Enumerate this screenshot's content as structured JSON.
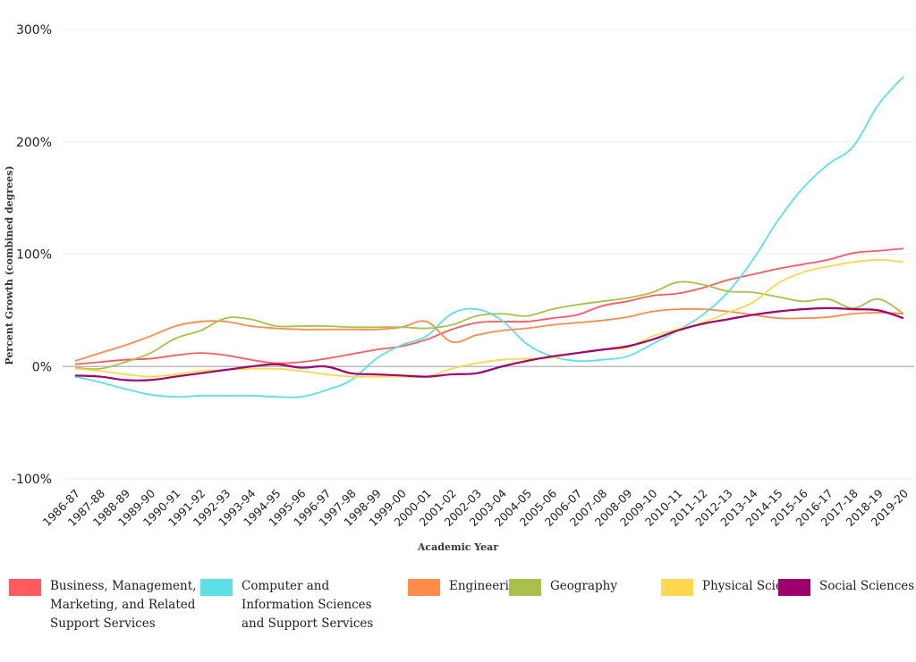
{
  "chart_data": {
    "type": "line",
    "title": "",
    "xlabel": "Academic Year",
    "ylabel": "Percent Growth  (combined degrees)",
    "ylim": [
      -100,
      300
    ],
    "yticks": [
      -100,
      0,
      100,
      200,
      300
    ],
    "ytick_labels": [
      "-100%",
      "0%",
      "100%",
      "200%",
      "300%"
    ],
    "grid": true,
    "legend_position": "bottom",
    "categories": [
      "1986-87",
      "1987-88",
      "1988-89",
      "1989-90",
      "1990-91",
      "1991-92",
      "1992-93",
      "1993-94",
      "1994-95",
      "1995-96",
      "1996-97",
      "1997-98",
      "1998-99",
      "1999-00",
      "2000-01",
      "2001-02",
      "2002-03",
      "2003-04",
      "2004-05",
      "2005-06",
      "2006-07",
      "2007-08",
      "2008-09",
      "2009-10",
      "2010-11",
      "2011-12",
      "2012-13",
      "2013-14",
      "2014-15",
      "2015-16",
      "2016-17",
      "2017-18",
      "2018-19",
      "2019-20"
    ],
    "series": [
      {
        "name": "Business, Management,\nMarketing, and Related\nSupport Services",
        "color": "#ff5a5f",
        "values": [
          2,
          4,
          6,
          7,
          10,
          12,
          10,
          6,
          3,
          4,
          7,
          11,
          15,
          18,
          24,
          33,
          39,
          40,
          40,
          43,
          46,
          54,
          58,
          63,
          65,
          70,
          77,
          82,
          87,
          91,
          95,
          101,
          103,
          105
        ]
      },
      {
        "name": "Computer and\nInformation Sciences\nand Support Services",
        "color": "#5ce0e6",
        "values": [
          -9,
          -14,
          -20,
          -25,
          -27,
          -26,
          -26,
          -26,
          -27,
          -27,
          -21,
          -12,
          7,
          19,
          27,
          47,
          51,
          41,
          20,
          9,
          5,
          6,
          9,
          20,
          32,
          46,
          66,
          95,
          130,
          159,
          180,
          196,
          233,
          258
        ]
      },
      {
        "name": "Engineering",
        "color": "#ff8c4b",
        "values": [
          5,
          12,
          19,
          27,
          36,
          40,
          40,
          36,
          34,
          33,
          33,
          33,
          33,
          35,
          40,
          22,
          28,
          32,
          34,
          37,
          39,
          41,
          44,
          49,
          51,
          51,
          49,
          46,
          43,
          43,
          44,
          47,
          48,
          47
        ]
      },
      {
        "name": "Geography",
        "color": "#a9c04b",
        "values": [
          -1,
          -2,
          4,
          12,
          25,
          32,
          43,
          42,
          36,
          36,
          36,
          35,
          35,
          35,
          34,
          37,
          45,
          47,
          45,
          51,
          55,
          58,
          61,
          66,
          75,
          73,
          67,
          66,
          62,
          58,
          60,
          52,
          60,
          47
        ]
      },
      {
        "name": "Physical Sciences",
        "color": "#ffd84d",
        "values": [
          -2,
          -4,
          -7,
          -9,
          -7,
          -4,
          -3,
          -2,
          -2,
          -4,
          -7,
          -9,
          -9,
          -9,
          -9,
          -2,
          3,
          6,
          7,
          8,
          12,
          15,
          17,
          27,
          33,
          39,
          48,
          57,
          74,
          84,
          89,
          93,
          95,
          93
        ]
      },
      {
        "name": "Social Sciences",
        "color": "#a0006e",
        "values": [
          -8,
          -9,
          -12,
          -12,
          -9,
          -6,
          -3,
          0,
          2,
          -1,
          0,
          -6,
          -7,
          -8,
          -9,
          -7,
          -6,
          0,
          5,
          9,
          12,
          15,
          18,
          24,
          32,
          38,
          42,
          46,
          49,
          51,
          52,
          51,
          50,
          43
        ]
      }
    ]
  }
}
